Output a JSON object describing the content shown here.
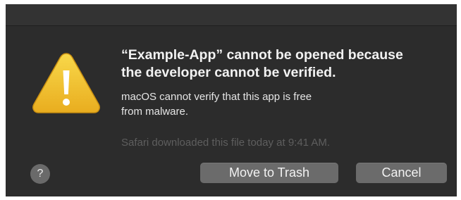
{
  "dialog": {
    "headline_line1": "“Example-App” cannot be opened because",
    "headline_line2": "the developer cannot be verified.",
    "body_line1": "macOS cannot verify that this app is free",
    "body_line2": "from malware.",
    "download_info": "Safari downloaded this file today at 9:41 AM.",
    "icon": "warning-icon",
    "icon_color": "#f2c12e"
  },
  "buttons": {
    "help_label": "?",
    "trash_label": "Move to Trash",
    "cancel_label": "Cancel"
  },
  "colors": {
    "dialog_background": "#2c2c2c",
    "button_background": "#6b6b6b",
    "text_primary": "#f2f2f2",
    "text_muted": "#5e5e5e"
  }
}
